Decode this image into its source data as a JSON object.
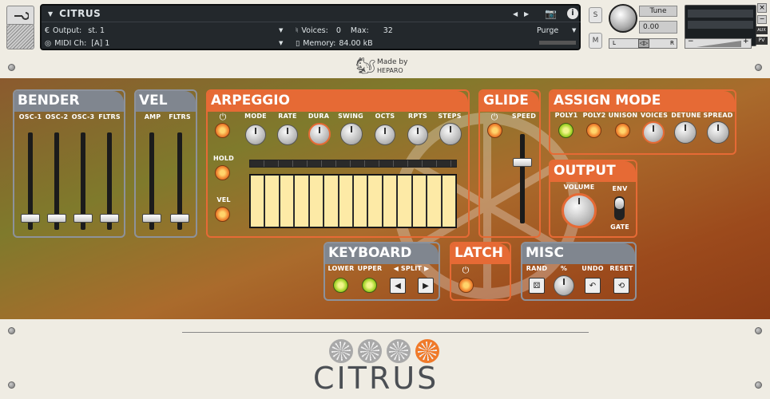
{
  "header": {
    "instrument_name": "CITRUS",
    "output_label": "Output:",
    "output_value": "st. 1",
    "midi_label": "MIDI Ch:",
    "midi_value": "[A]  1",
    "voices_label": "Voices:",
    "voices_value": "0",
    "max_label": "Max:",
    "max_value": "32",
    "memory_label": "Memory:",
    "memory_value": "84.00 kB",
    "purge_label": "Purge",
    "solo_label": "S",
    "mute_label": "M",
    "tune_label": "Tune",
    "tune_value": "0.00",
    "pan_left": "L",
    "pan_right": "R",
    "aux_label": "AUX",
    "pv_label": "PV",
    "close_label": "×"
  },
  "banner": {
    "made_by": "Made by",
    "brand": "HEPARO"
  },
  "bender": {
    "title": "BENDER",
    "labels": [
      "OSC-1",
      "OSC-2",
      "OSC-3",
      "FLTRS"
    ]
  },
  "vel": {
    "title": "VEL",
    "labels": [
      "AMP",
      "FLTRS"
    ]
  },
  "arpeggio": {
    "title": "ARPEGGIO",
    "power": "⏻",
    "knob_labels": [
      "MODE",
      "RATE",
      "DURA",
      "SWING",
      "OCTS",
      "RPTS",
      "STEPS"
    ],
    "hold_label": "HOLD",
    "vel_label": "VEL",
    "step_count": 14
  },
  "glide": {
    "title": "GLIDE",
    "power": "⏻",
    "speed_label": "SPEED"
  },
  "assign_mode": {
    "title": "ASSIGN MODE",
    "labels": [
      "POLY1",
      "POLY2",
      "UNISON",
      "VOICES",
      "DETUNE",
      "SPREAD"
    ]
  },
  "output": {
    "title": "OUTPUT",
    "volume_label": "VOLUME",
    "env_label": "ENV",
    "gate_label": "GATE"
  },
  "keyboard": {
    "title": "KEYBOARD",
    "lower_label": "LOWER",
    "upper_label": "UPPER",
    "split_label": "◀ SPLIT ▶",
    "left_arrow": "◀",
    "right_arrow": "▶"
  },
  "latch": {
    "title": "LATCH",
    "power": "⏻"
  },
  "misc": {
    "title": "MISC",
    "labels": [
      "RAND",
      "%",
      "UNDO",
      "RESET"
    ]
  },
  "footer": {
    "logo_text": "CITRUS"
  },
  "colors": {
    "accent_orange": "#e66a35",
    "panel_gray": "#80868f",
    "header_bg": "#23282c"
  }
}
